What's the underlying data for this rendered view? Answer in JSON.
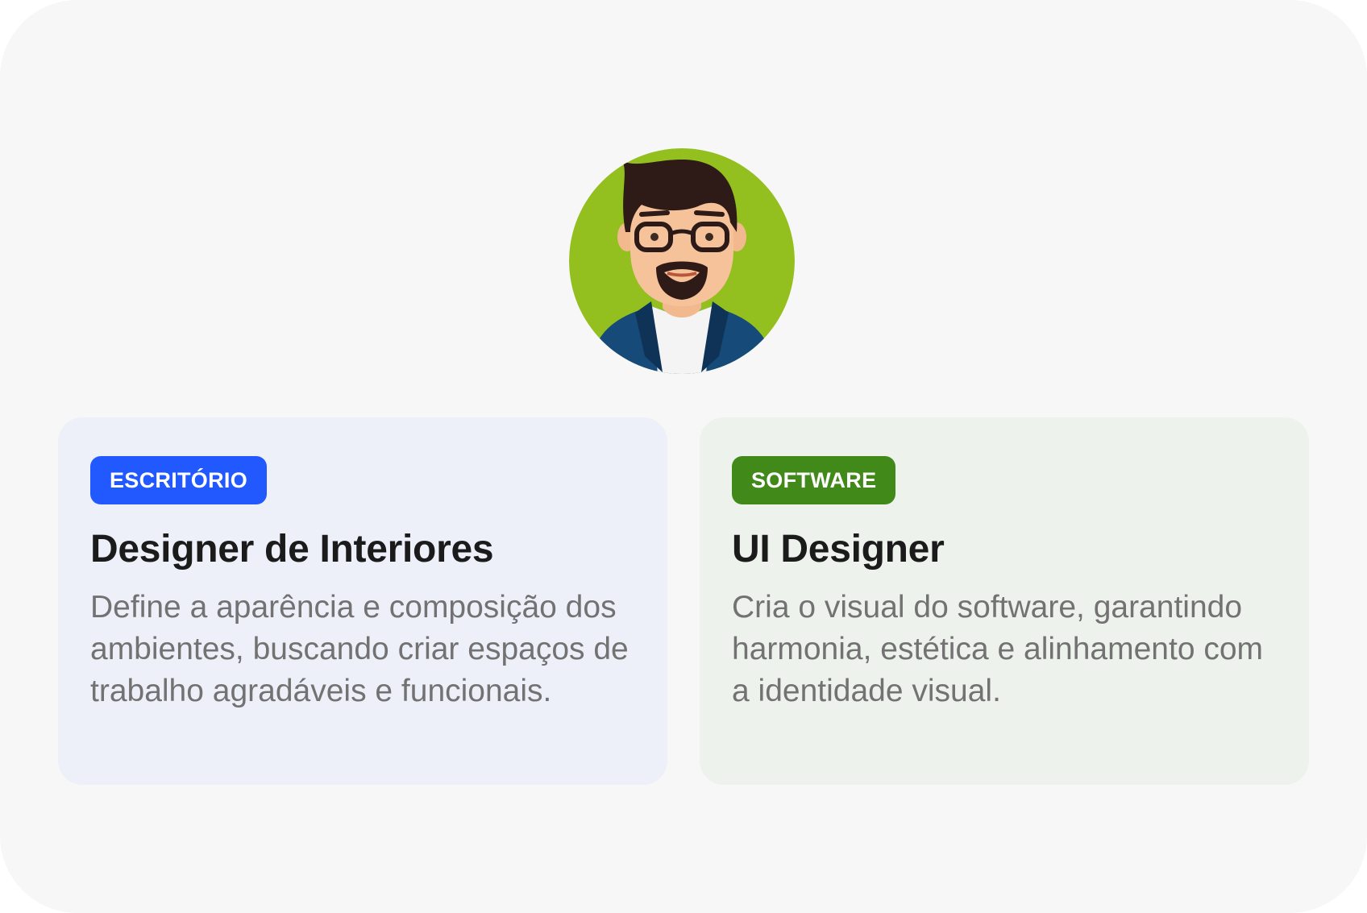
{
  "profile": {
    "avatar_icon": "man-with-glasses-avatar-icon",
    "avatar_bg": "#93c01f"
  },
  "cards": [
    {
      "badge": "ESCRITÓRIO",
      "badge_color": "#2259ff",
      "title": "Designer de Interiores",
      "description": "Define a aparência e composição dos ambientes, buscando criar espaços de trabalho agradáveis e funcionais."
    },
    {
      "badge": "SOFTWARE",
      "badge_color": "#418a1a",
      "title": "UI Designer",
      "description": "Cria o visual do software, garantindo harmonia, estética e alinhamento com a identidade visual."
    }
  ]
}
